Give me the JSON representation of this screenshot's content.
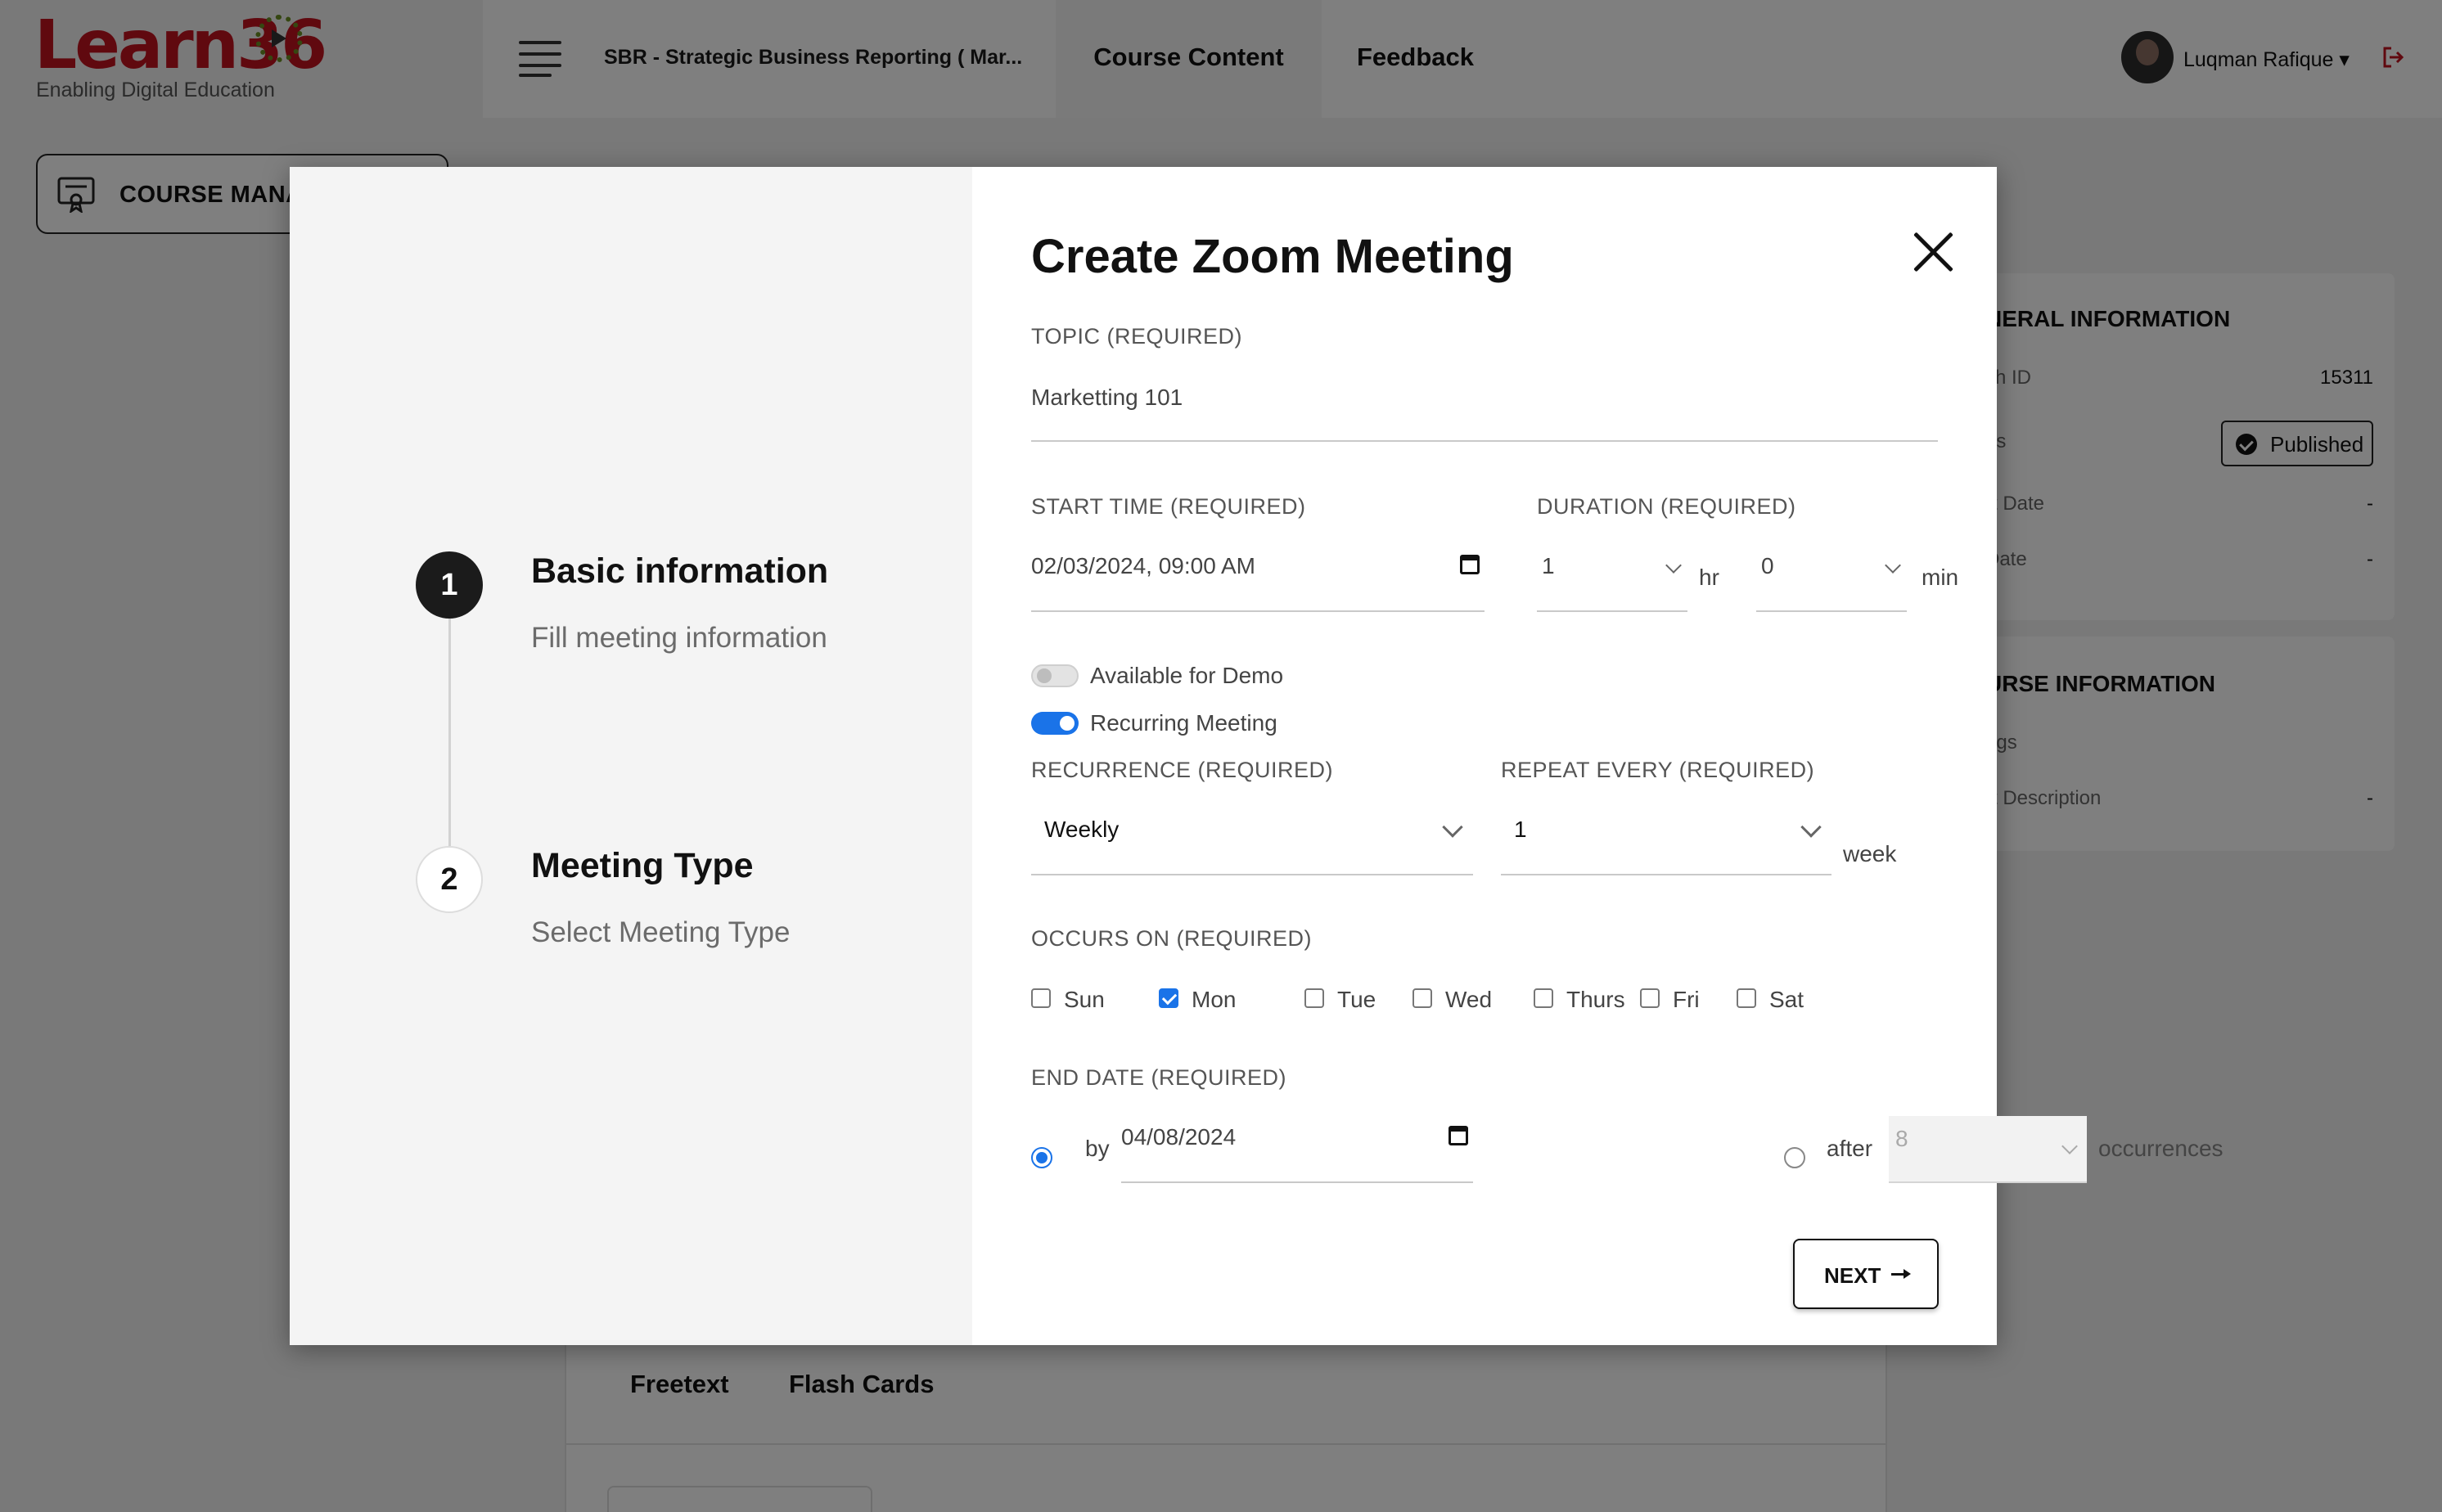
{
  "app": {
    "logo_text": "Learn36",
    "logo_tagline": "Enabling Digital Education",
    "course_title": "SBR - Strategic Business Reporting ( Mar...",
    "nav_tabs": [
      "Course Content",
      "Feedback"
    ],
    "user_name": "Luqman Rafique ▾"
  },
  "sidebar": {
    "button_label": "Course Manage"
  },
  "general_panel": {
    "heading": "NERAL INFORMATION",
    "rows": [
      {
        "label": "ch ID",
        "value": "15311"
      },
      {
        "label": "us",
        "value": ""
      },
      {
        "label": "rt Date",
        "value": "-"
      },
      {
        "label": "Date",
        "value": "-"
      }
    ],
    "status_badge": "Published"
  },
  "course_panel": {
    "heading": "URSE INFORMATION",
    "rows": [
      {
        "label": "ngs",
        "value": ""
      },
      {
        "label": "rt Description",
        "value": "-"
      }
    ]
  },
  "bottom_tabs": [
    "Freetext",
    "Flash Cards"
  ],
  "modal": {
    "title": "Create Zoom Meeting",
    "steps": [
      {
        "number": "1",
        "title": "Basic information",
        "subtitle": "Fill meeting information",
        "active": true
      },
      {
        "number": "2",
        "title": "Meeting Type",
        "subtitle": "Select Meeting Type",
        "active": false
      }
    ],
    "topic": {
      "label": "TOPIC (REQUIRED)",
      "value": "Marketting 101"
    },
    "start_time": {
      "label": "START TIME (REQUIRED)",
      "value": "02/03/2024, 09:00 AM"
    },
    "duration": {
      "label": "DURATION (REQUIRED)",
      "hours": "1",
      "hours_unit": "hr",
      "minutes": "0",
      "minutes_unit": "min"
    },
    "toggles": [
      {
        "label": "Available for Demo",
        "on": false
      },
      {
        "label": "Recurring Meeting",
        "on": true
      }
    ],
    "recurrence": {
      "label": "RECURRENCE (REQUIRED)",
      "value": "Weekly"
    },
    "repeat_every": {
      "label": "REPEAT EVERY (REQUIRED)",
      "value": "1",
      "unit": "week"
    },
    "occurs_on": {
      "label": "OCCURS ON (REQUIRED)",
      "days": [
        {
          "name": "Sun",
          "checked": false
        },
        {
          "name": "Mon",
          "checked": true
        },
        {
          "name": "Tue",
          "checked": false
        },
        {
          "name": "Wed",
          "checked": false
        },
        {
          "name": "Thurs",
          "checked": false
        },
        {
          "name": "Fri",
          "checked": false
        },
        {
          "name": "Sat",
          "checked": false
        }
      ]
    },
    "end_date": {
      "label": "END DATE (REQUIRED)",
      "by_label": "by",
      "by_value": "04/08/2024",
      "after_label": "after",
      "after_value": "8",
      "occurrences_label": "occurrences",
      "selected": "by"
    },
    "next_button": "NEXT"
  },
  "colors": {
    "brand_red": "#c1121f",
    "accent_blue": "#1a73e8",
    "overlay": "rgba(0,0,0,0.5)"
  },
  "icons": [
    "hamburger-menu-icon",
    "logout-icon",
    "certificate-icon",
    "check-circle-icon",
    "close-icon",
    "calendar-icon",
    "chevron-down-icon",
    "arrow-right-icon"
  ]
}
